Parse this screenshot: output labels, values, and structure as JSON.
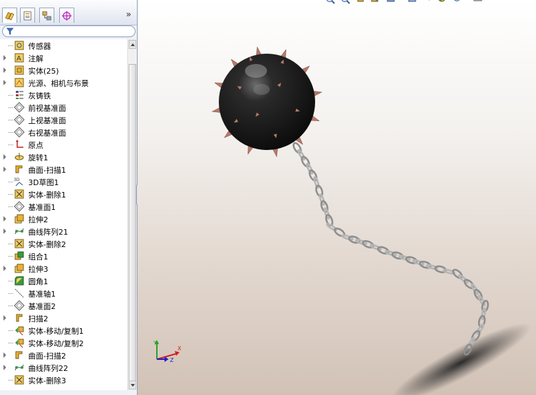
{
  "tree": {
    "items": [
      {
        "label": "传感器",
        "icon": "sensor-icon",
        "expandable": false
      },
      {
        "label": "注解",
        "icon": "annotation-icon",
        "expandable": true
      },
      {
        "label": "实体(25)",
        "icon": "solid-bodies-icon",
        "expandable": true
      },
      {
        "label": "光源、相机与布景",
        "icon": "lights-cameras-icon",
        "expandable": true
      },
      {
        "label": "灰铸铁",
        "icon": "material-icon",
        "expandable": false
      },
      {
        "label": "前视基准面",
        "icon": "plane-icon",
        "expandable": false
      },
      {
        "label": "上视基准面",
        "icon": "plane-icon",
        "expandable": false
      },
      {
        "label": "右视基准面",
        "icon": "plane-icon",
        "expandable": false
      },
      {
        "label": "原点",
        "icon": "origin-icon",
        "expandable": false
      },
      {
        "label": "旋转1",
        "icon": "revolve-icon",
        "expandable": true
      },
      {
        "label": "曲面-扫描1",
        "icon": "surface-sweep-icon",
        "expandable": true
      },
      {
        "label": "3D草图1",
        "icon": "sketch-3d-icon",
        "expandable": false
      },
      {
        "label": "实体-删除1",
        "icon": "delete-body-icon",
        "expandable": false
      },
      {
        "label": "基准面1",
        "icon": "plane-icon",
        "expandable": false
      },
      {
        "label": "拉伸2",
        "icon": "extrude-icon",
        "expandable": true
      },
      {
        "label": "曲线阵列21",
        "icon": "curve-pattern-icon",
        "expandable": true
      },
      {
        "label": "实体-删除2",
        "icon": "delete-body-icon",
        "expandable": false
      },
      {
        "label": "组合1",
        "icon": "combine-icon",
        "expandable": false
      },
      {
        "label": "拉伸3",
        "icon": "extrude-icon",
        "expandable": true
      },
      {
        "label": "圆角1",
        "icon": "fillet-icon",
        "expandable": false
      },
      {
        "label": "基准轴1",
        "icon": "axis-icon",
        "expandable": false
      },
      {
        "label": "基准面2",
        "icon": "plane-icon",
        "expandable": false
      },
      {
        "label": "扫描2",
        "icon": "sweep-icon",
        "expandable": true
      },
      {
        "label": "实体-移动/复制1",
        "icon": "move-copy-icon",
        "expandable": false
      },
      {
        "label": "实体-移动/复制2",
        "icon": "move-copy-icon",
        "expandable": false
      },
      {
        "label": "曲面-扫描2",
        "icon": "surface-sweep-icon",
        "expandable": true
      },
      {
        "label": "曲线阵列22",
        "icon": "curve-pattern-icon",
        "expandable": true
      },
      {
        "label": "实体-删除3",
        "icon": "delete-body-icon",
        "expandable": false
      }
    ]
  },
  "tabs": [
    {
      "icon": "feature-manager-icon",
      "active": true
    },
    {
      "icon": "property-manager-icon",
      "active": false
    },
    {
      "icon": "configuration-manager-icon",
      "active": false
    },
    {
      "icon": "dimxpert-manager-icon",
      "active": false
    }
  ],
  "expand_arrows": "»",
  "colors": {
    "panel_bg": "#eef1f7",
    "ball": "#1a1a1a",
    "spikes": "#b8786a",
    "chain": "#9a9a9a",
    "viewport_top": "#ffffff",
    "viewport_bottom": "#d2c2b6"
  }
}
